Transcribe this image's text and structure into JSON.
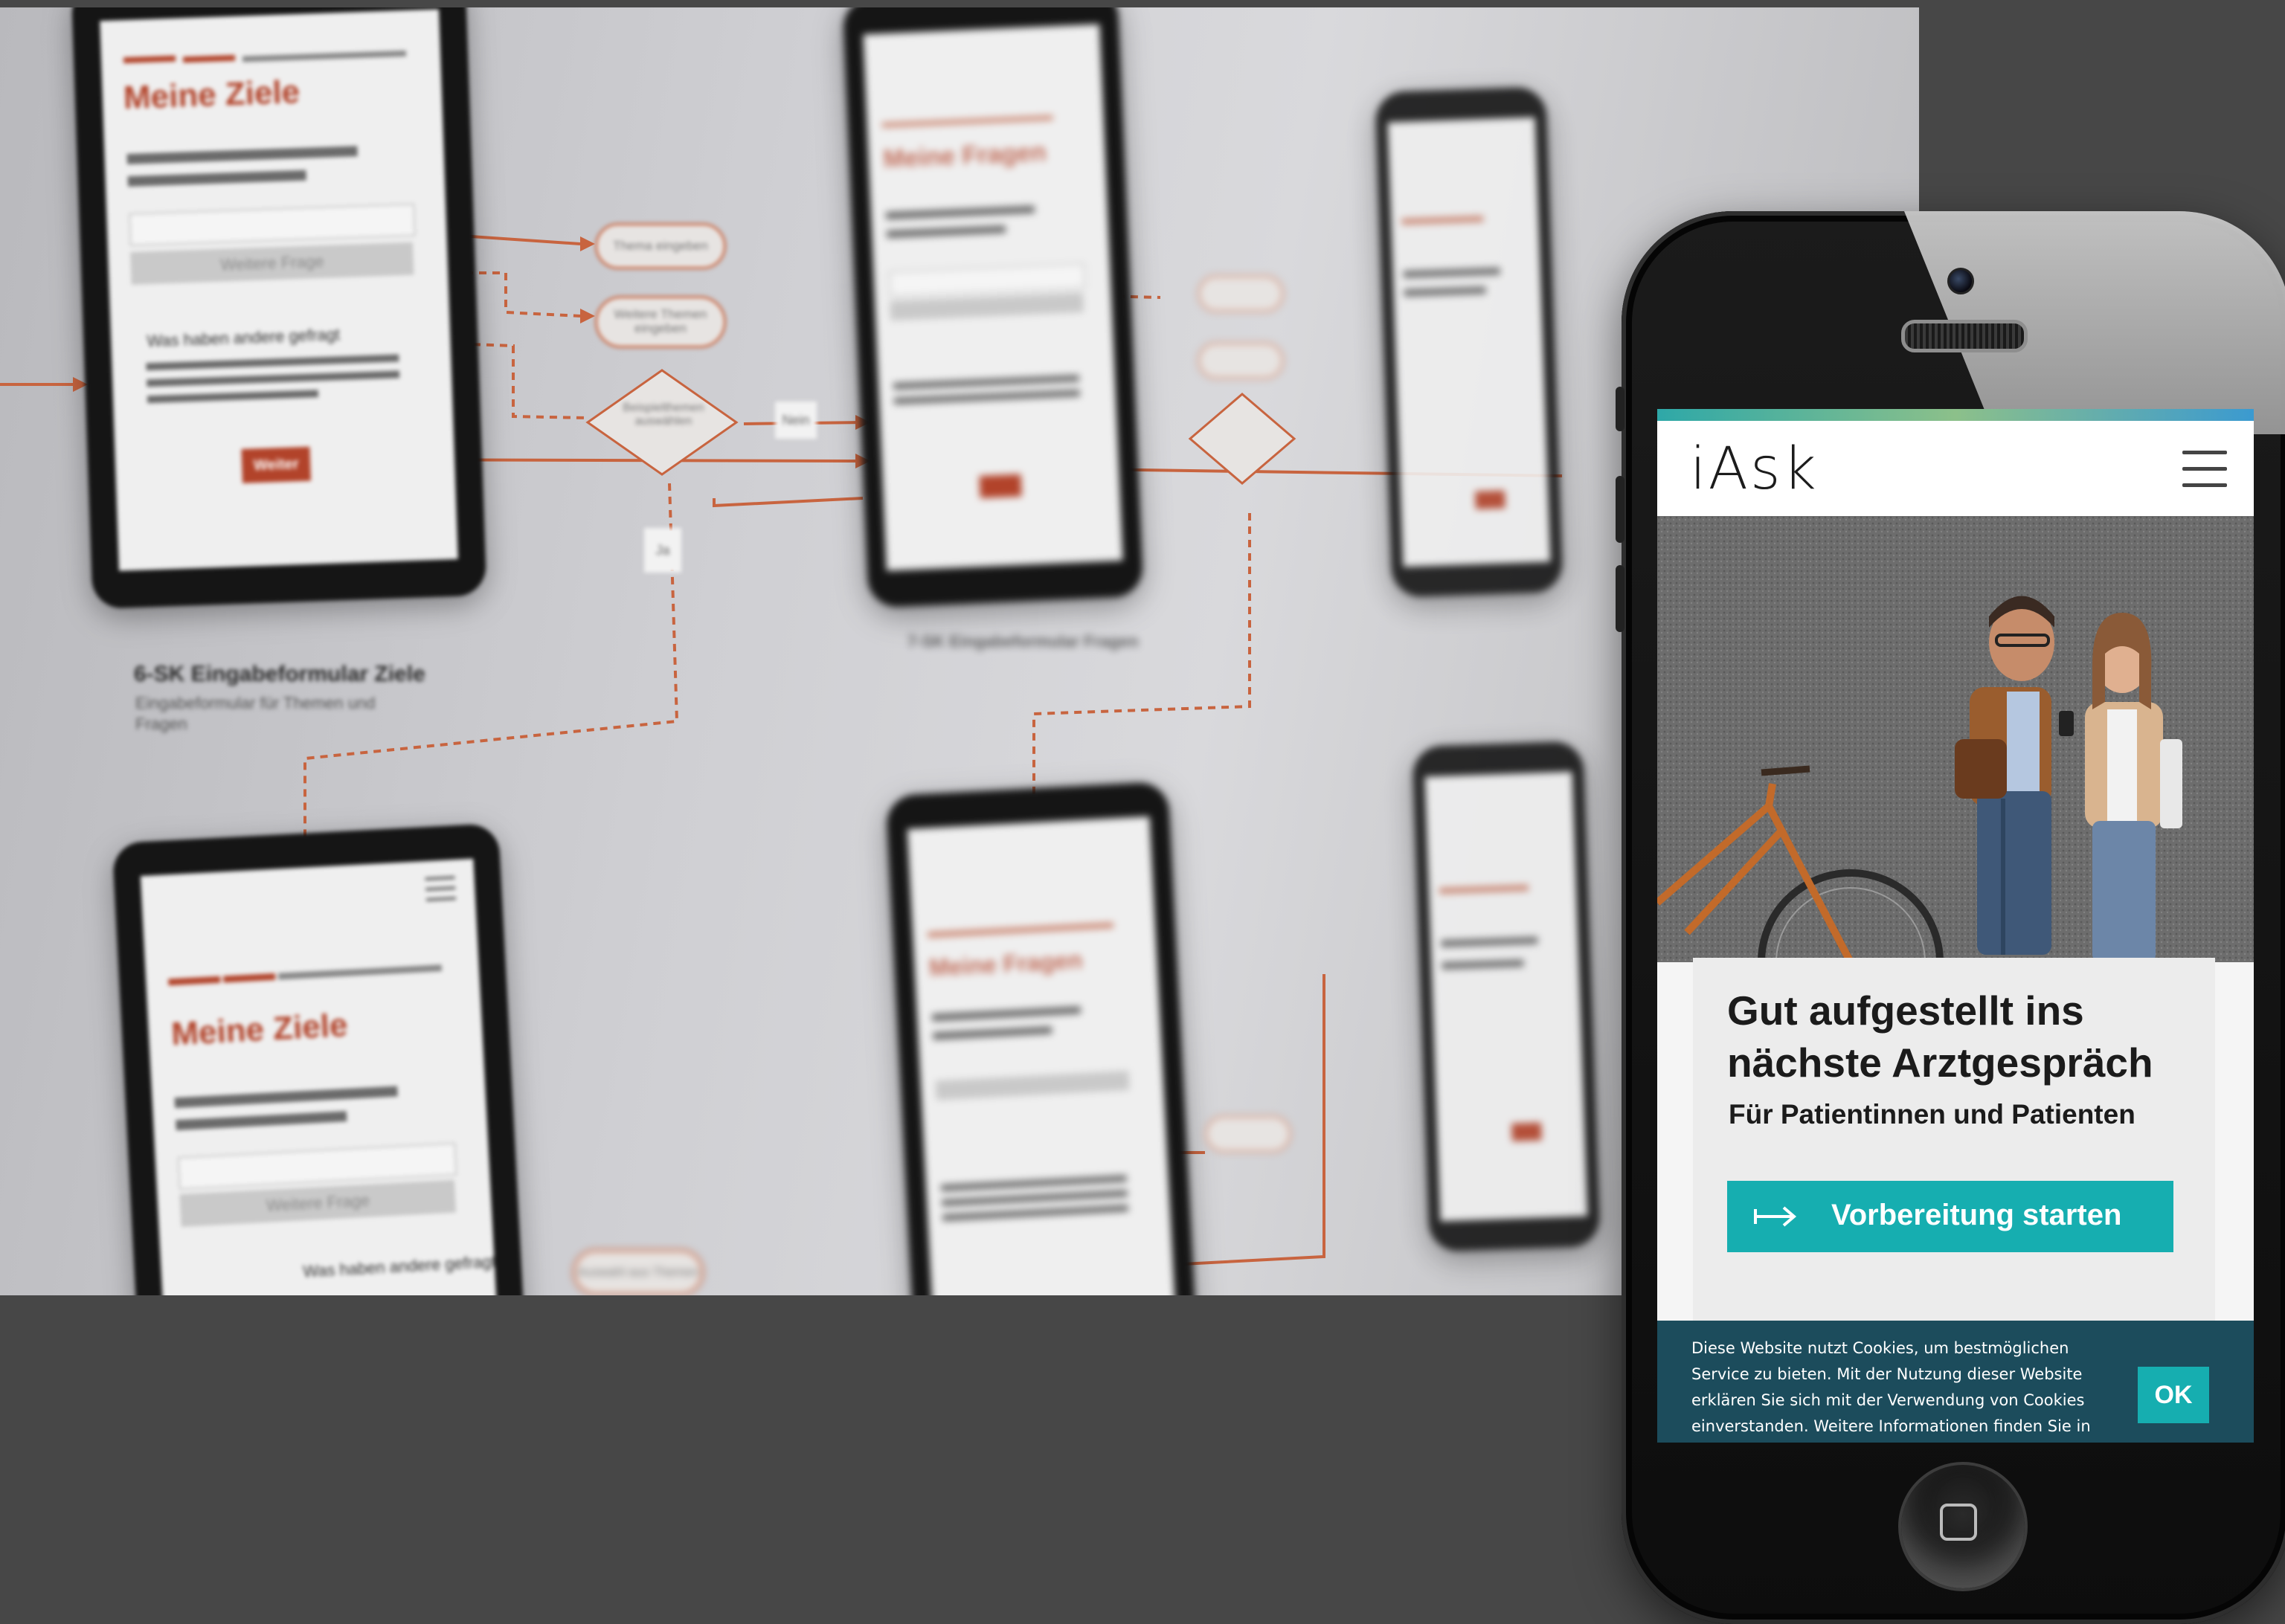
{
  "board": {
    "wireframes": [
      {
        "title": "Meine Ziele",
        "secondary_button": "Weitere Frage",
        "question": "Was haben andere gefragt",
        "primary_button": "Weiter"
      },
      {
        "title": "Meine Fragen"
      },
      {
        "title": "Meine Ziele",
        "secondary_button": "Weitere Frage",
        "question": "Was haben andere gefragt"
      },
      {
        "title": "Meine Fragen"
      }
    ],
    "caption_main": {
      "title": "6-SK Eingabeformular Ziele",
      "subtitle": "Eingabeformular für Themen und Fragen"
    },
    "caption_second": {
      "title": "7-SK Eingabeformular Fragen"
    },
    "pills": [
      "Thema eingeben",
      "Weitere Themen eingeben",
      "Auswahl aus Themen"
    ],
    "decision": "Beispielthemen auswählen",
    "branch_no": "Nein",
    "branch_yes": "Ja"
  },
  "site": {
    "logo": "iAsk",
    "hero_title": "Gut aufgestellt ins\nnächste Arztgespräch",
    "hero_subtitle": "Für Patientinnen und Patienten",
    "cta_label": "Vorbereitung starten",
    "cookie_text": "Diese Website nutzt Cookies, um bestmöglichen Service zu bieten. Mit der Nutzung dieser Website erklären Sie sich mit der Verwendung von Cookies einverstanden. Weitere Informationen finden Sie in",
    "cookie_ok": "OK"
  },
  "colors": {
    "accent": "#16aeb0",
    "cookie_bg": "#1c4c5c",
    "wireframe_red": "#b2432a"
  }
}
